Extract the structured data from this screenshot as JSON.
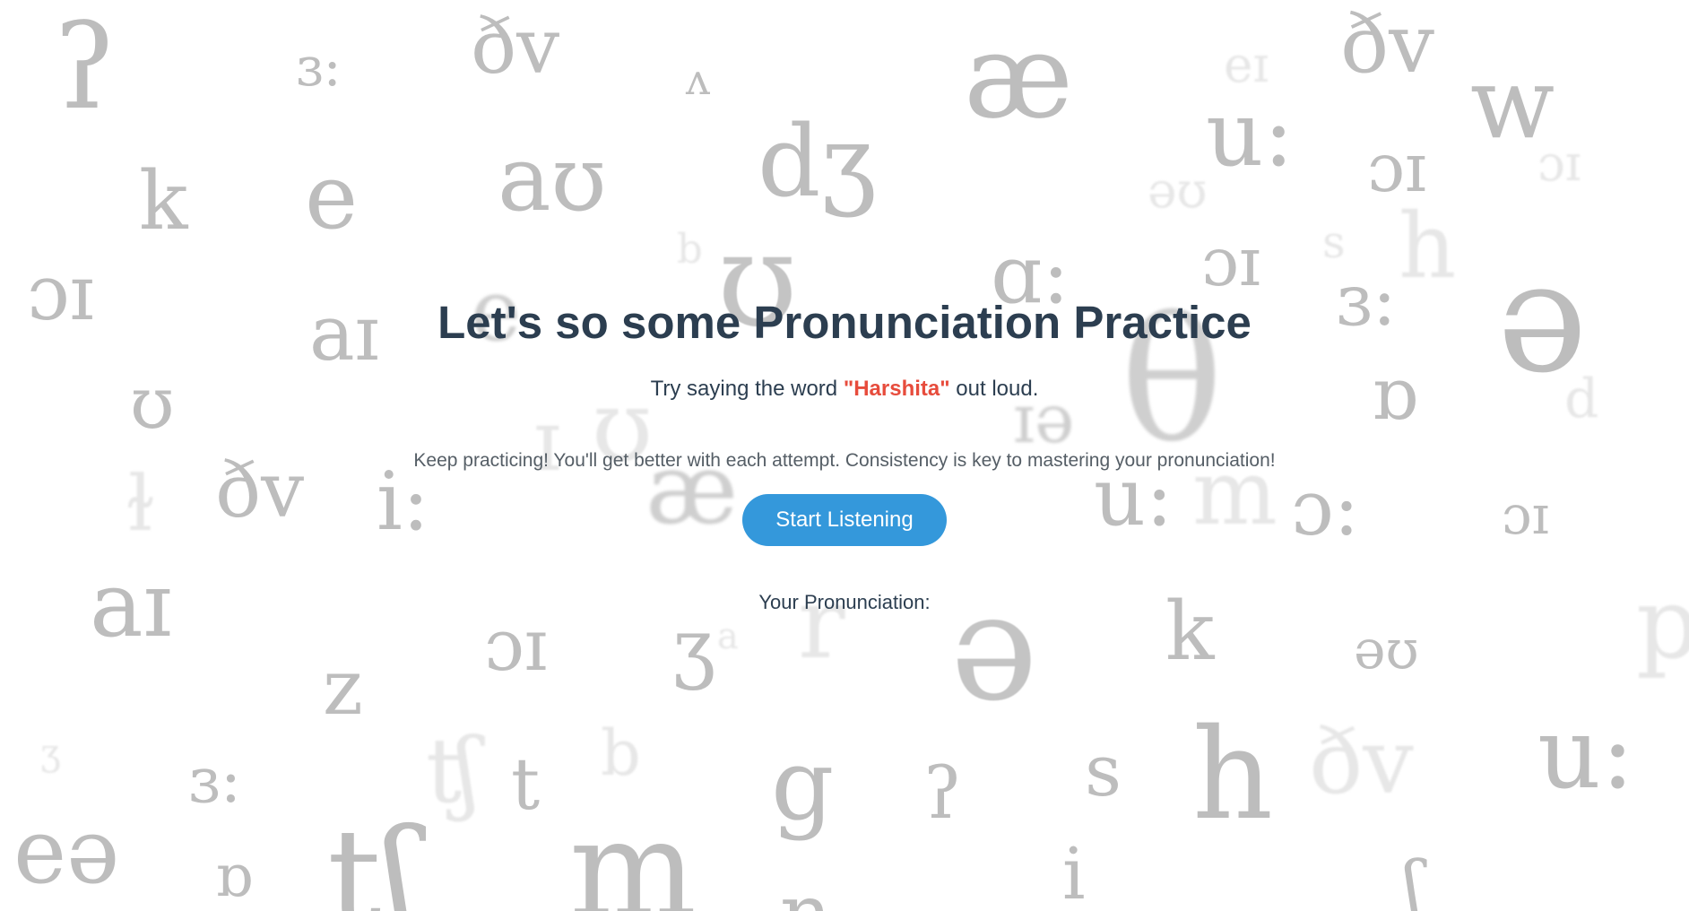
{
  "page": {
    "title": "Let's so some Pronunciation Practice",
    "prompt_prefix": "Try saying the word",
    "target_word": "\"Harshita\"",
    "prompt_suffix": "out loud.",
    "encouragement": "Keep practicing! You'll get better with each attempt. Consistency is key to mastering your pronunciation!",
    "start_button_label": "Start Listening",
    "result_label": "Your Pronunciation:"
  },
  "background_symbols": [
    "ʔ",
    "ɜ:",
    "ðv",
    "ʌ",
    "æ",
    "eɪ",
    "u:",
    "ðv",
    "w",
    "k",
    "e",
    "aʊ",
    "dʒ",
    "əʊ",
    "ɔɪ",
    "ɔɪ",
    "ɔɪ",
    "b",
    "ʊ",
    "ɑ:",
    "ɔɪ",
    "s",
    "h",
    "ɜ:",
    "ə",
    "aɪ",
    "e",
    "ʊ",
    "θ",
    "ɒ",
    "ɪə",
    "d",
    "ɪ",
    "ʊ",
    "ðv",
    "i:",
    "æ",
    "u:",
    "m",
    "ɔ:",
    "ɔɪ",
    "ɫ",
    "aɪ",
    "ɔɪ",
    "ʒ",
    "r",
    "ə",
    "k",
    "əʊ",
    "p",
    "z",
    "ɜ:",
    "ʧ",
    "t",
    "b",
    "g",
    "ʔ",
    "s",
    "h",
    "ðv",
    "u:",
    "eə",
    "ɒ",
    "tʃ",
    "m",
    "n",
    "i",
    "ʃ",
    "ʒ",
    "a"
  ],
  "colors": {
    "title": "#2c3e50",
    "highlight": "#e74c3c",
    "button": "#3498db",
    "button_text": "#ffffff",
    "background": "#ffffff",
    "background_symbols": "#bdbdbd"
  },
  "icons": []
}
